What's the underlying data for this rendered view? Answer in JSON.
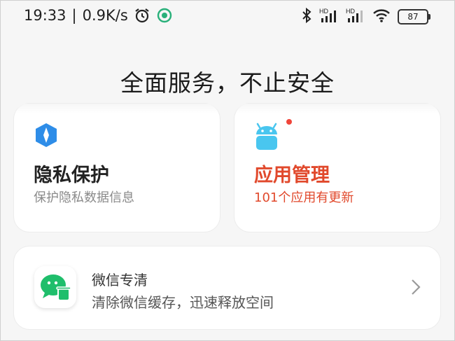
{
  "status_bar": {
    "time": "19:33",
    "separator": "|",
    "speed": "0.9K/s",
    "battery": "87",
    "signal_label_1": "HD",
    "signal_label_2": "HD"
  },
  "page": {
    "title": "全面服务，不止安全"
  },
  "cards": {
    "privacy": {
      "title": "隐私保护",
      "subtitle": "保护隐私数据信息"
    },
    "apps": {
      "title": "应用管理",
      "subtitle": "101个应用有更新"
    }
  },
  "wechat_clean": {
    "title": "微信专清",
    "subtitle": "清除微信缓存，迅速释放空间"
  },
  "colors": {
    "accent": "#e1492c",
    "privacy_icon": "#2e8de8",
    "android_icon": "#49c6ef",
    "wechat_green": "#1fbe6b"
  },
  "icons": [
    "alarm-icon",
    "sync-icon",
    "bluetooth-icon",
    "signal-icon",
    "wifi-icon",
    "battery-icon",
    "shield-icon",
    "android-icon",
    "wechat-clean-icon",
    "chevron-right-icon"
  ]
}
